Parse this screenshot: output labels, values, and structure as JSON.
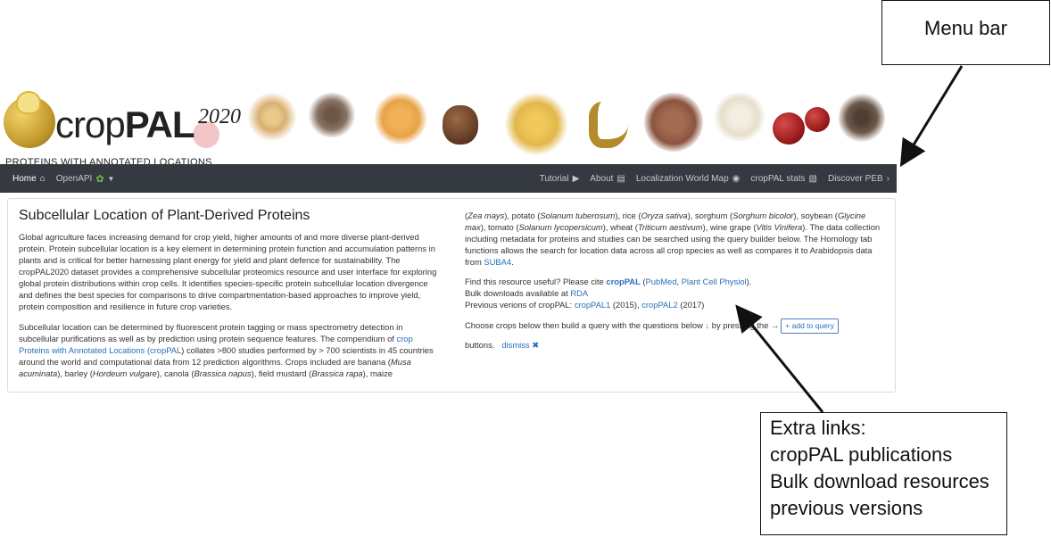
{
  "banner": {
    "logo_crop": "crop",
    "logo_pal": "PAL",
    "logo_year": "2020",
    "tagline": "PROTEINS WITH ANNOTATED LOCATIONS"
  },
  "navbar": {
    "home": "Home",
    "openapi": "OpenAPI",
    "tutorial": "Tutorial",
    "about": "About",
    "world_map": "Localization World Map",
    "stats": "cropPAL stats",
    "discover": "Discover PEB"
  },
  "main": {
    "title": "Subcellular Location of Plant-Derived Proteins",
    "p1": "Global agriculture faces increasing demand for crop yield, higher amounts of and more diverse plant-derived protein. Protein subcellular location is a key element in determining protein function and accumulation patterns in plants and is critical for better harnessing plant energy for yield and plant defence for sustainability. The cropPAL2020 dataset provides a comprehensive subcellular proteomics resource and user interface for exploring global protein distributions within crop cells. It identifies species-specific protein subcellular location divergence and defines the best species for comparisons to drive compartmentation-based approaches to improve yield, protein composition and resilience in future crop varieties.",
    "p2": {
      "a": "Subcellular location can be determined by fluorescent protein tagging or mass spectrometry detection in subcellular purifications as well as by prediction using protein sequence features. The compendium of ",
      "crop_link1": "crop",
      "crop_link2": "Proteins with Annotated Locations (",
      "crop_link3": "cropPAL",
      "b": ") collates >800 studies performed by > 700 scientists in 45 countries around the world and computational data from 12 prediction algorithms. Crops included are banana (",
      "banana": "Musa acuminata",
      "c": "), barley (",
      "barley": "Hordeum vulgare",
      "d": "), canola (",
      "canola": "Brassica napus",
      "e": "), field mustard (",
      "mustard": "Brassica rapa",
      "f": "), maize"
    },
    "r1": {
      "a": "(",
      "maize": "Zea mays",
      "b": "), potato (",
      "potato": "Solanum tuberosum",
      "c": "), rice (",
      "rice": "Oryza sativa",
      "d": "), sorghum (",
      "sorghum": "Sorghum bicolor",
      "e": "), soybean (",
      "soybean": "Glycine max",
      "f": "), tomato (",
      "tomato": "Solanum lycopersicum",
      "g": "), wheat (",
      "wheat": "Triticum aestivum",
      "h": "), wine grape (",
      "grape": "Vitis Vinifera",
      "i": "). The data collection including metadata for proteins and studies can be searched using the query builder below. The Homology tab functions allows the search for location data across all crop species as well as compares it to Arabidopsis data from ",
      "suba": "SUBA4",
      "j": "."
    },
    "cite": {
      "a": "Find this resource useful? Please cite ",
      "croppal": "cropPAL",
      "b": " (",
      "pubmed": "PubMed",
      "c": ", ",
      "plantcell": "Plant Cell Physiol",
      "d": ")."
    },
    "bulk": {
      "a": "Bulk downloads available at ",
      "rda": "RDA"
    },
    "prev": {
      "a": "Previous verions of cropPAL: ",
      "pal1": "cropPAL1",
      "b": " (2015), ",
      "pal2": "cropPAL2",
      "c": " (2017)"
    },
    "choose": {
      "a": "Choose crops below then build a query with the questions below ",
      "arrow": "↓",
      "b": " by pressing the →",
      "btn": "+ add to query",
      "c": "buttons.",
      "dismiss": "dismiss ✖"
    }
  },
  "annotations": {
    "menu_bar": "Menu bar",
    "extra_1": "Extra links:",
    "extra_2": "cropPAL publications",
    "extra_3": "Bulk download resources",
    "extra_4": "previous versions"
  }
}
